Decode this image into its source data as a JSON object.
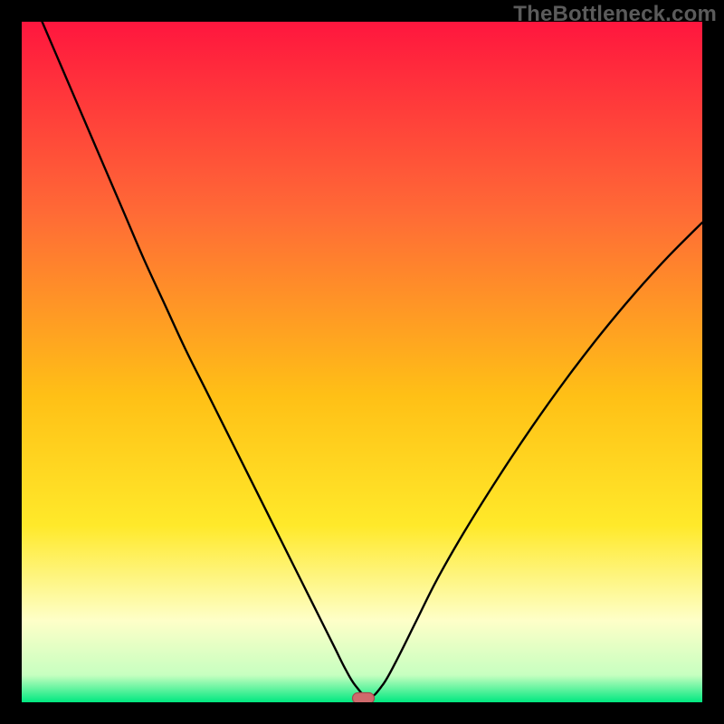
{
  "watermark": "TheBottleneck.com",
  "colors": {
    "frame": "#000000",
    "grad_top": "#ff163e",
    "grad_mid_upper": "#ff6a36",
    "grad_mid": "#ffc016",
    "grad_mid_lower": "#ffe92a",
    "grad_pale": "#feffc8",
    "grad_green": "#00e880",
    "curve": "#000000",
    "marker_fill": "#cf6a6c",
    "marker_stroke": "#a24b4e"
  },
  "chart_data": {
    "type": "line",
    "title": "",
    "xlabel": "",
    "ylabel": "",
    "xlim": [
      0,
      100
    ],
    "ylim": [
      0,
      100
    ],
    "x": [
      3,
      6,
      9,
      12,
      15,
      18,
      21,
      24,
      27,
      30,
      33,
      36,
      38,
      40,
      42,
      44,
      46,
      47.5,
      49,
      51,
      53,
      55,
      58,
      61,
      65,
      70,
      75,
      80,
      85,
      90,
      95,
      100
    ],
    "values": [
      100,
      93,
      86,
      79,
      72,
      65,
      58.5,
      52,
      46,
      40,
      34,
      28,
      24,
      20,
      16,
      12,
      8,
      5,
      2.5,
      0.7,
      2.5,
      6,
      12,
      18,
      25,
      33,
      40.5,
      47.5,
      54,
      60,
      65.5,
      70.5
    ],
    "marker": {
      "x": 50.2,
      "y": 0.6
    },
    "annotations": []
  }
}
